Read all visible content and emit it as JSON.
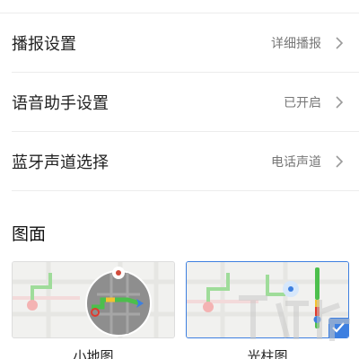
{
  "settings": {
    "rows": [
      {
        "label": "播报设置",
        "value": "详细播报"
      },
      {
        "label": "语音助手设置",
        "value": "已开启"
      },
      {
        "label": "蓝牙声道选择",
        "value": "电话声道"
      }
    ]
  },
  "display": {
    "section_title": "图面",
    "options": [
      {
        "label": "小地图",
        "selected": false
      },
      {
        "label": "光柱图",
        "selected": true
      }
    ]
  },
  "colors": {
    "accent": "#3d7fe0",
    "route_green": "#4cbf4c",
    "traffic_yellow": "#f2c230",
    "traffic_red": "#e03a2e"
  },
  "icons": [
    "chevron-right-icon",
    "checkmark-icon",
    "compass-icon",
    "navigation-arrow-icon",
    "start-point-icon"
  ]
}
